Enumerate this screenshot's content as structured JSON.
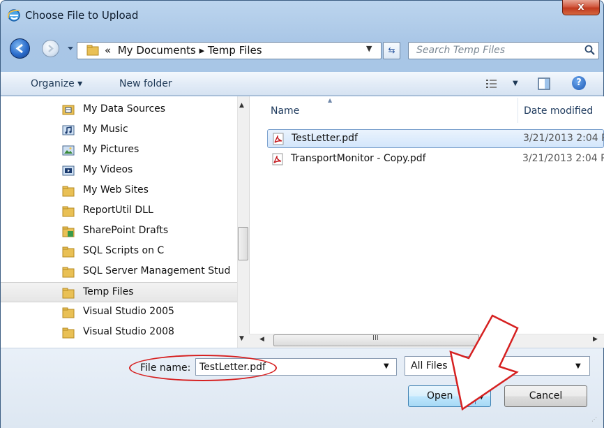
{
  "window": {
    "title": "Choose File to Upload",
    "close_label": "x"
  },
  "address": {
    "chevron": "«",
    "path": "My Documents ▸ Temp Files"
  },
  "search": {
    "placeholder": "Search Temp Files"
  },
  "toolbar": {
    "organize_label": "Organize ▾",
    "new_folder_label": "New folder"
  },
  "tree": {
    "items": [
      {
        "label": "My Data Sources",
        "icon": "data-sources-icon"
      },
      {
        "label": "My Music",
        "icon": "music-icon"
      },
      {
        "label": "My Pictures",
        "icon": "pictures-icon"
      },
      {
        "label": "My Videos",
        "icon": "videos-icon"
      },
      {
        "label": "My Web Sites",
        "icon": "folder-icon"
      },
      {
        "label": "ReportUtil DLL",
        "icon": "folder-icon"
      },
      {
        "label": "SharePoint Drafts",
        "icon": "sharepoint-folder-icon"
      },
      {
        "label": "SQL Scripts on C",
        "icon": "folder-icon"
      },
      {
        "label": "SQL Server Management Stud",
        "icon": "folder-icon"
      },
      {
        "label": "Temp Files",
        "icon": "folder-icon",
        "selected": true
      },
      {
        "label": "Visual Studio 2005",
        "icon": "folder-icon"
      },
      {
        "label": "Visual Studio 2008",
        "icon": "folder-icon"
      }
    ]
  },
  "files": {
    "columns": {
      "name": "Name",
      "date": "Date modified"
    },
    "rows": [
      {
        "name": "TestLetter.pdf",
        "date": "3/21/2013 2:04 P",
        "selected": true,
        "icon": "pdf-icon"
      },
      {
        "name": "TransportMonitor - Copy.pdf",
        "date": "3/21/2013 2:04 P",
        "selected": false,
        "icon": "pdf-icon"
      }
    ]
  },
  "bottom": {
    "file_name_label": "File name:",
    "file_name_value": "TestLetter.pdf",
    "file_type_value": "All Files",
    "open_label": "Open",
    "cancel_label": "Cancel"
  },
  "colors": {
    "annotation": "#d62020",
    "accent": "#3c7fb1"
  }
}
